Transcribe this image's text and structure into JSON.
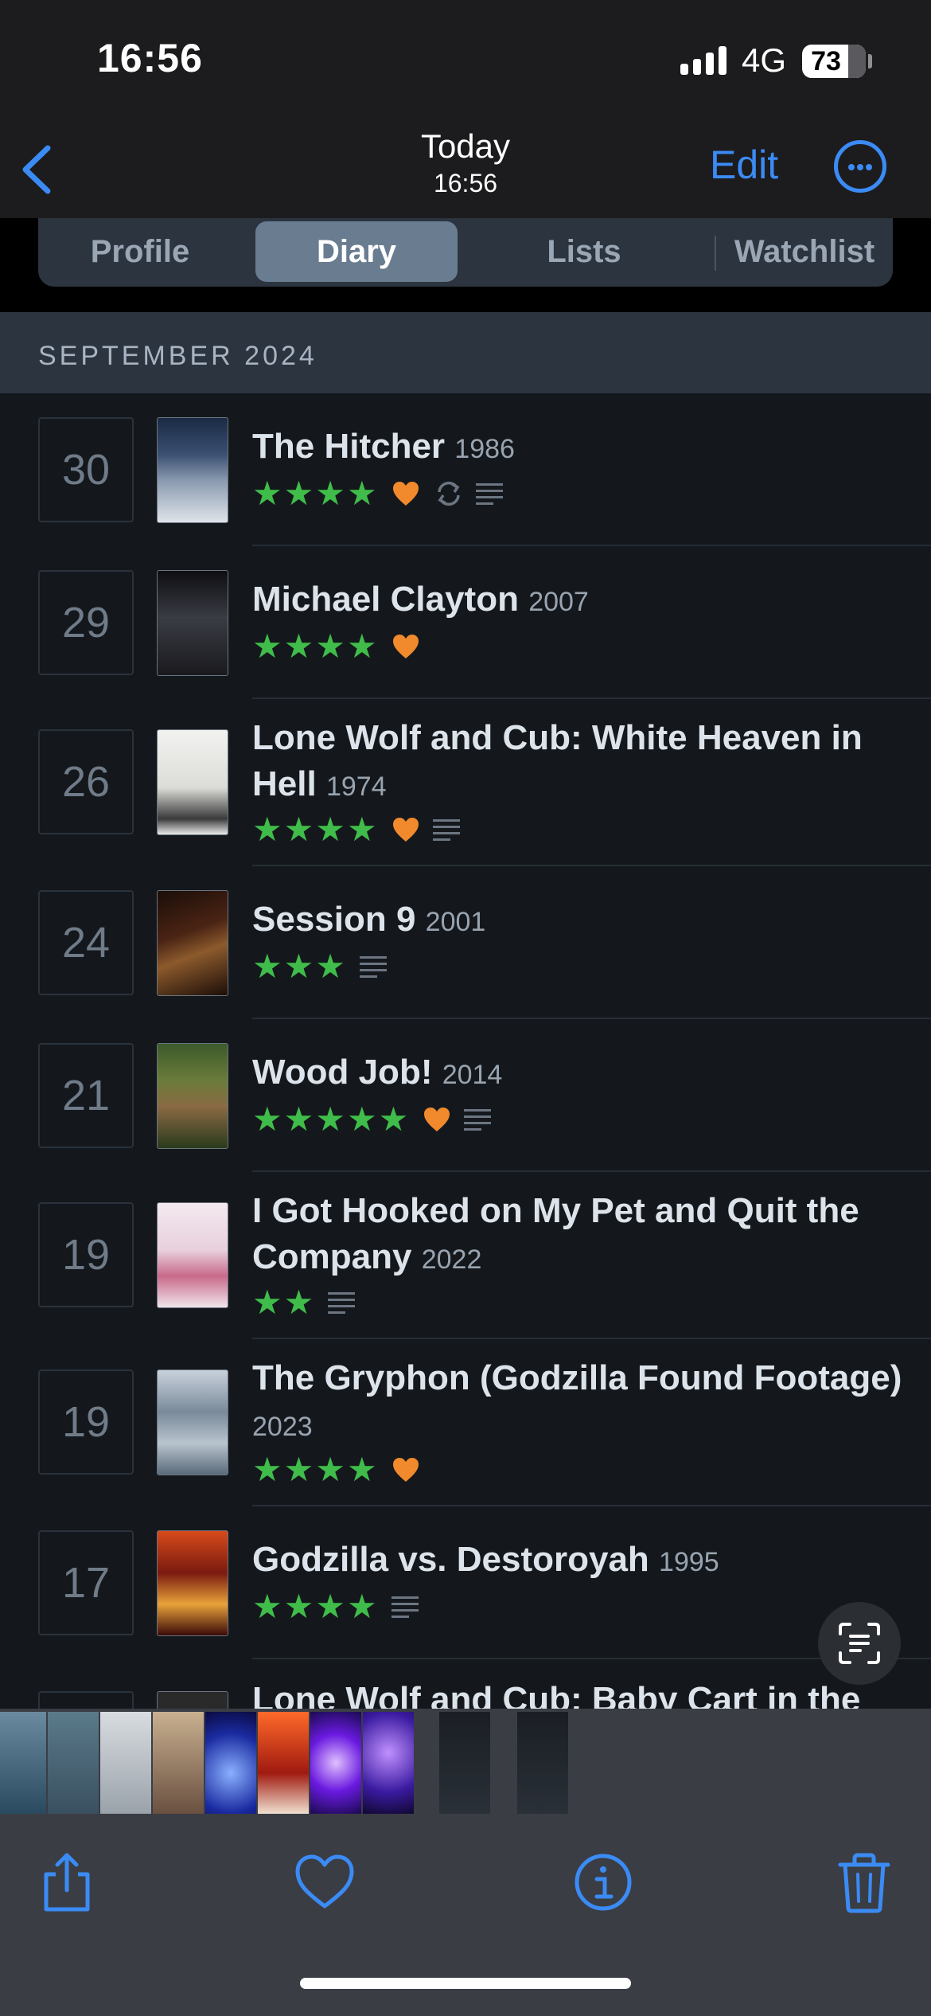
{
  "status_bar": {
    "time": "16:56",
    "network": "4G",
    "battery": "73"
  },
  "nav": {
    "title": "Today",
    "subtitle": "16:56",
    "edit_label": "Edit"
  },
  "tabs": [
    {
      "label": "Profile",
      "active": false
    },
    {
      "label": "Diary",
      "active": true
    },
    {
      "label": "Lists",
      "active": false
    },
    {
      "label": "Watchlist",
      "active": false
    }
  ],
  "month_header": "SEPTEMBER 2024",
  "entries": [
    {
      "day": "30",
      "title": "The Hitcher",
      "year": "1986",
      "rating_stars": 4,
      "liked": true,
      "rewatch": true,
      "review": true
    },
    {
      "day": "29",
      "title": "Michael Clayton",
      "year": "2007",
      "rating_stars": 4,
      "liked": true,
      "rewatch": false,
      "review": false
    },
    {
      "day": "26",
      "title": "Lone Wolf and Cub: White Heaven in Hell",
      "year": "1974",
      "rating_stars": 4,
      "liked": true,
      "rewatch": false,
      "review": true
    },
    {
      "day": "24",
      "title": "Session 9",
      "year": "2001",
      "rating_stars": 3,
      "liked": false,
      "rewatch": false,
      "review": true
    },
    {
      "day": "21",
      "title": "Wood Job!",
      "year": "2014",
      "rating_stars": 5,
      "liked": true,
      "rewatch": false,
      "review": true
    },
    {
      "day": "19",
      "title": "I Got Hooked on My Pet and Quit the Company",
      "year": "2022",
      "rating_stars": 2,
      "liked": false,
      "rewatch": false,
      "review": true
    },
    {
      "day": "19",
      "title": "The Gryphon (Godzilla Found Footage)",
      "year": "2023",
      "rating_stars": 4,
      "liked": true,
      "rewatch": false,
      "review": false
    },
    {
      "day": "17",
      "title": "Godzilla vs. Destoroyah",
      "year": "1995",
      "rating_stars": 4,
      "liked": false,
      "rewatch": false,
      "review": true
    },
    {
      "day": "",
      "title": "Lone Wolf and Cub: Baby Cart in the",
      "year": "",
      "rating_stars": 0,
      "liked": false,
      "rewatch": false,
      "review": false
    }
  ],
  "colors": {
    "accent_blue": "#3b8bf5",
    "star_green": "#40bc4a",
    "heart_orange": "#f08a2c",
    "background": "#14181c",
    "header_band": "#2c3440"
  },
  "icons": {
    "back": "chevron-left-icon",
    "more": "ellipsis-circle-icon",
    "liked": "heart-icon",
    "rewatch": "rewatch-icon",
    "review": "review-lines-icon",
    "live_text": "live-text-icon",
    "share": "share-icon",
    "favorite": "heart-outline-icon",
    "info": "info-icon",
    "delete": "trash-icon"
  }
}
